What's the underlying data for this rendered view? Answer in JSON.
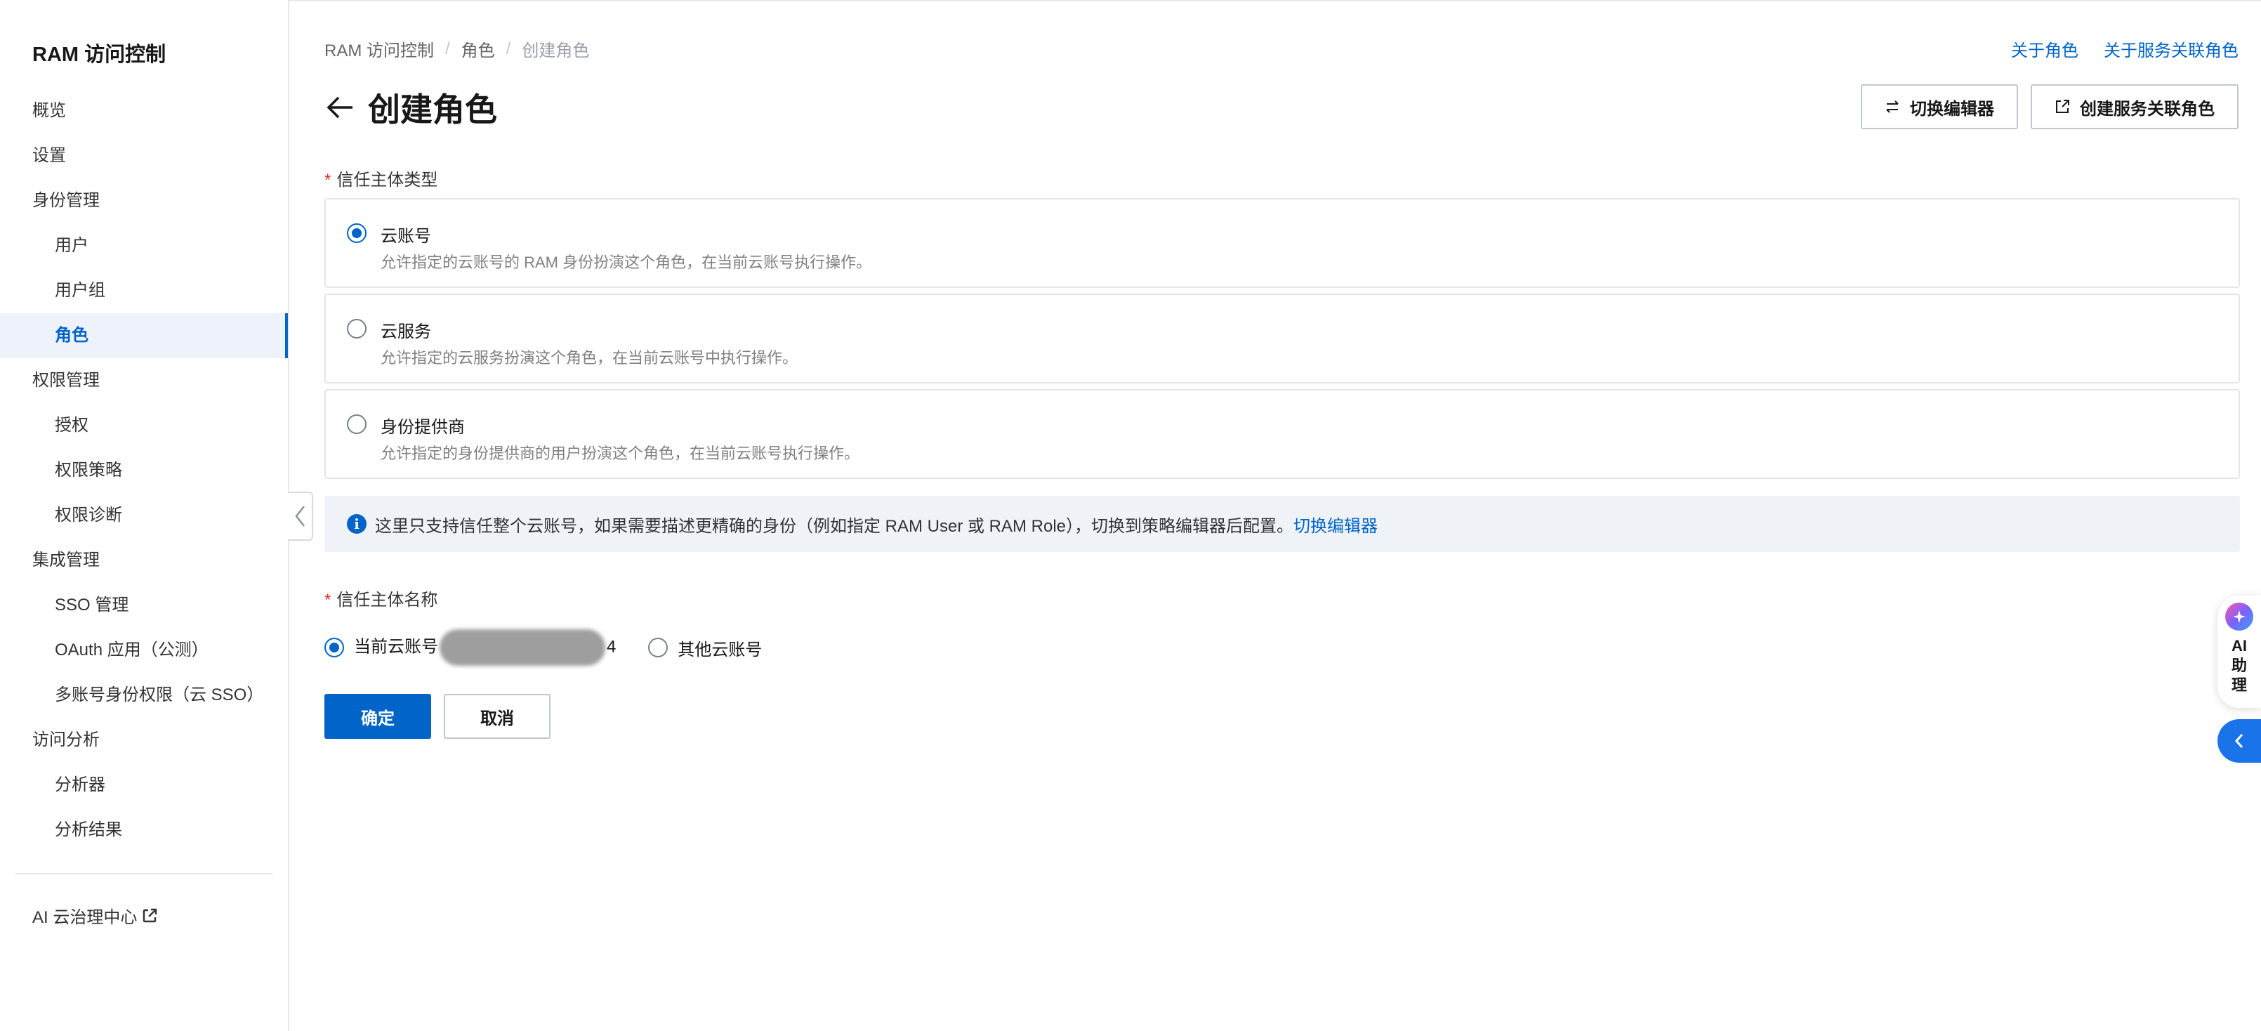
{
  "sidebar": {
    "title": "RAM 访问控制",
    "items": [
      {
        "label": "概览",
        "level": 0,
        "active": false
      },
      {
        "label": "设置",
        "level": 0,
        "active": false
      },
      {
        "label": "身份管理",
        "level": 0,
        "active": false
      },
      {
        "label": "用户",
        "level": 1,
        "active": false
      },
      {
        "label": "用户组",
        "level": 1,
        "active": false
      },
      {
        "label": "角色",
        "level": 1,
        "active": true
      },
      {
        "label": "权限管理",
        "level": 0,
        "active": false
      },
      {
        "label": "授权",
        "level": 1,
        "active": false
      },
      {
        "label": "权限策略",
        "level": 1,
        "active": false
      },
      {
        "label": "权限诊断",
        "level": 1,
        "active": false
      },
      {
        "label": "集成管理",
        "level": 0,
        "active": false
      },
      {
        "label": "SSO 管理",
        "level": 1,
        "active": false
      },
      {
        "label": "OAuth 应用（公测）",
        "level": 1,
        "active": false
      },
      {
        "label": "多账号身份权限（云 SSO）",
        "level": 1,
        "active": false
      },
      {
        "label": "访问分析",
        "level": 0,
        "active": false
      },
      {
        "label": "分析器",
        "level": 1,
        "active": false
      },
      {
        "label": "分析结果",
        "level": 1,
        "active": false
      }
    ],
    "external_link": "AI 云治理中心"
  },
  "breadcrumb": [
    "RAM 访问控制",
    "角色",
    "创建角色"
  ],
  "top_links": {
    "about_role": "关于角色",
    "about_service_role": "关于服务关联角色"
  },
  "page_title": "创建角色",
  "header_buttons": {
    "switch_editor": "切换编辑器",
    "create_service_role": "创建服务关联角色"
  },
  "trust_type": {
    "label": "信任主体类型",
    "options": [
      {
        "title": "云账号",
        "desc": "允许指定的云账号的 RAM 身份扮演这个角色，在当前云账号执行操作。",
        "checked": true
      },
      {
        "title": "云服务",
        "desc": "允许指定的云服务扮演这个角色，在当前云账号中执行操作。",
        "checked": false
      },
      {
        "title": "身份提供商",
        "desc": "允许指定的身份提供商的用户扮演这个角色，在当前云账号执行操作。",
        "checked": false
      }
    ]
  },
  "info": {
    "text": "这里只支持信任整个云账号，如果需要描述更精确的身份（例如指定 RAM User 或 RAM Role），切换到策略编辑器后配置。",
    "link": "切换编辑器"
  },
  "trust_name": {
    "label": "信任主体名称",
    "current_prefix": "当前云账号",
    "current_suffix": "4",
    "other": "其他云账号"
  },
  "actions": {
    "confirm": "确定",
    "cancel": "取消"
  },
  "ai_assistant": {
    "label": "AI助理"
  },
  "colors": {
    "primary": "#0064c8",
    "required": "#d93026",
    "info_bg": "#eff3f8"
  }
}
